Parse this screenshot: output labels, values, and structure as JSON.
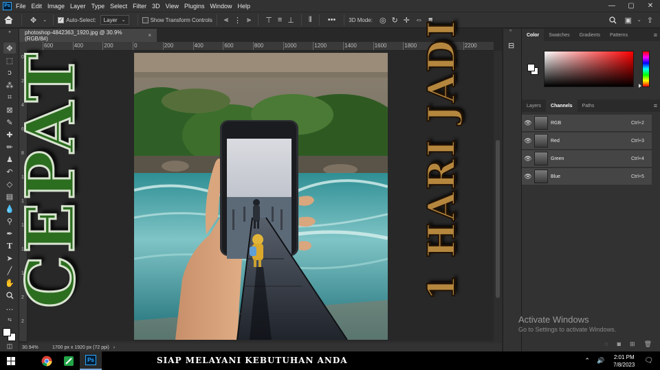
{
  "menubar": {
    "app_badge": "Ps",
    "items": [
      "File",
      "Edit",
      "Image",
      "Layer",
      "Type",
      "Select",
      "Filter",
      "3D",
      "View",
      "Plugins",
      "Window",
      "Help"
    ],
    "icons": [
      "minimize-icon",
      "maximize-icon",
      "close-icon"
    ]
  },
  "options": {
    "auto_select_label": "Auto-Select:",
    "auto_select_checked": true,
    "auto_select_value": "Layer",
    "show_transform_label": "Show Transform Controls",
    "show_transform_checked": false,
    "mode_3d_label": "3D Mode:",
    "more_label": "•••"
  },
  "document": {
    "tab_title": "photoshop-4842363_1920.jpg @ 30.9% (RGB/8#)",
    "tab_close": "×",
    "zoom": "30.94%",
    "size_info": "1700 px x 1920 px (72 ppi)",
    "text_left": "CEPAT",
    "text_right": "1 HARI JADI"
  },
  "rulers": {
    "horizontal": [
      "600",
      "400",
      "200",
      "0",
      "200",
      "400",
      "600",
      "800",
      "1000",
      "1200",
      "1400",
      "1600",
      "1800",
      "2000",
      "2200"
    ],
    "vertical": [
      "0",
      "2",
      "4",
      "6",
      "8",
      "1",
      "1",
      "1",
      "1",
      "1",
      "2",
      "2"
    ]
  },
  "panels": {
    "color_tabs": [
      "Color",
      "Swatches",
      "Gradients",
      "Patterns"
    ],
    "color_active": "Color",
    "channel_tabs": [
      "Layers",
      "Channels",
      "Paths"
    ],
    "channel_active": "Channels",
    "channels": [
      {
        "name": "RGB",
        "shortcut": "Ctrl+2"
      },
      {
        "name": "Red",
        "shortcut": "Ctrl+3"
      },
      {
        "name": "Green",
        "shortcut": "Ctrl+4"
      },
      {
        "name": "Blue",
        "shortcut": "Ctrl+5"
      }
    ]
  },
  "watermark": {
    "title": "Activate Windows",
    "subtitle": "Go to Settings to activate Windows."
  },
  "taskbar": {
    "banner": "SIAP MELAYANI KEBUTUHAN ANDA",
    "time": "2:01 PM",
    "date": "7/8/2023",
    "apps": [
      "windows-start-icon",
      "chrome-icon",
      "green-app-icon",
      "photoshop-icon"
    ]
  },
  "colors": {
    "ps_blue": "#31a8ff",
    "panel_bg": "#323232",
    "canvas_bg": "#282828",
    "cepat_green": "#2c6e1f",
    "hari_gold": "#b5873e"
  }
}
